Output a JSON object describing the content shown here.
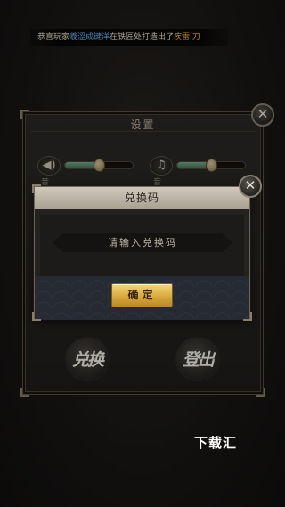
{
  "marquee": {
    "prefix": "恭喜玩家",
    "player": "羲涩成键洋",
    "middle": "在铁匠处打造出了",
    "item": "疾雷·刀"
  },
  "settings": {
    "title": "设置",
    "music_label": "音乐",
    "sfx_label": "音效",
    "music_level": 0.5,
    "sfx_level": 0.5,
    "redeem_button": "兑换",
    "logout_button": "登出"
  },
  "dialog": {
    "title": "兑换码",
    "input_placeholder": "请输入兑换码",
    "confirm_label": "确定"
  },
  "watermark": "下载汇",
  "icons": {
    "close": "close-icon",
    "music": "speaker-icon",
    "sfx": "music-note-icon"
  }
}
